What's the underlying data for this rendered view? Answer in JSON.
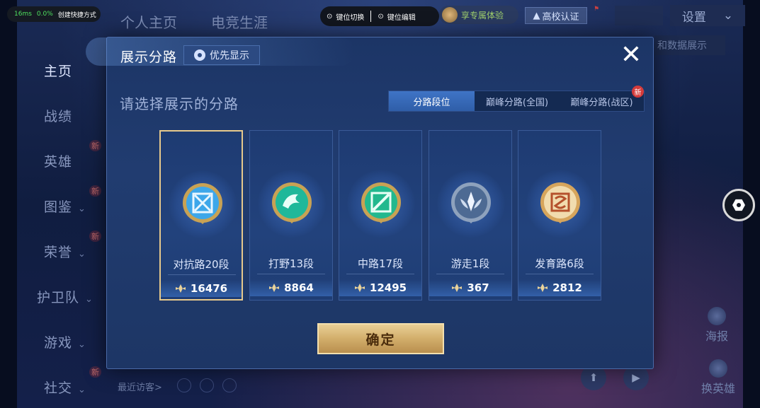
{
  "perf": {
    "ping": "16ms",
    "loss": "0.0%",
    "shortcut": "创建快捷方式"
  },
  "header": {
    "tabs": [
      "个人主页",
      "电竞生涯"
    ],
    "key_switch": "键位切换",
    "key_edit": "键位编辑",
    "vip": "享专属体验",
    "cert": "高校认证",
    "settings": "设置",
    "data_btn": "和数据展示"
  },
  "sidebar": {
    "items": [
      {
        "label": "主页",
        "chev": false,
        "new": false
      },
      {
        "label": "战绩",
        "chev": false,
        "new": false
      },
      {
        "label": "英雄",
        "chev": false,
        "new": true
      },
      {
        "label": "图鉴",
        "chev": true,
        "new": true
      },
      {
        "label": "荣誉",
        "chev": true,
        "new": true
      },
      {
        "label": "护卫队",
        "chev": true,
        "new": false
      },
      {
        "label": "游戏",
        "chev": true,
        "new": false
      },
      {
        "label": "社交",
        "chev": true,
        "new": true
      }
    ],
    "new_label": "新"
  },
  "right_tools": {
    "poster": "海报",
    "swap_hero": "换英雄"
  },
  "recent_visitors": "最近访客>",
  "modal": {
    "title": "展示分路",
    "priority_label": "优先显示",
    "close_symbol": "✕",
    "prompt": "请选择展示的分路",
    "tabs": [
      {
        "label": "分路段位",
        "active": true,
        "new": false
      },
      {
        "label": "巅峰分路(全国)",
        "active": false,
        "new": false
      },
      {
        "label": "巅峰分路(战区)",
        "active": false,
        "new": true
      }
    ],
    "new_tag": "新",
    "cards": [
      {
        "name": "对抗路20段",
        "score": "16476",
        "selected": true,
        "emblem": "clash-lane-emblem-icon",
        "color": "#3da7ea"
      },
      {
        "name": "打野13段",
        "score": "8864",
        "selected": false,
        "emblem": "jungle-emblem-icon",
        "color": "#1fb89a"
      },
      {
        "name": "中路17段",
        "score": "12495",
        "selected": false,
        "emblem": "mid-lane-emblem-icon",
        "color": "#22b88e"
      },
      {
        "name": "游走1段",
        "score": "367",
        "selected": false,
        "emblem": "roam-emblem-icon",
        "color": "#9ab0cc"
      },
      {
        "name": "发育路6段",
        "score": "2812",
        "selected": false,
        "emblem": "farm-lane-emblem-icon",
        "color": "#e0a45a"
      }
    ],
    "confirm": "确定"
  }
}
